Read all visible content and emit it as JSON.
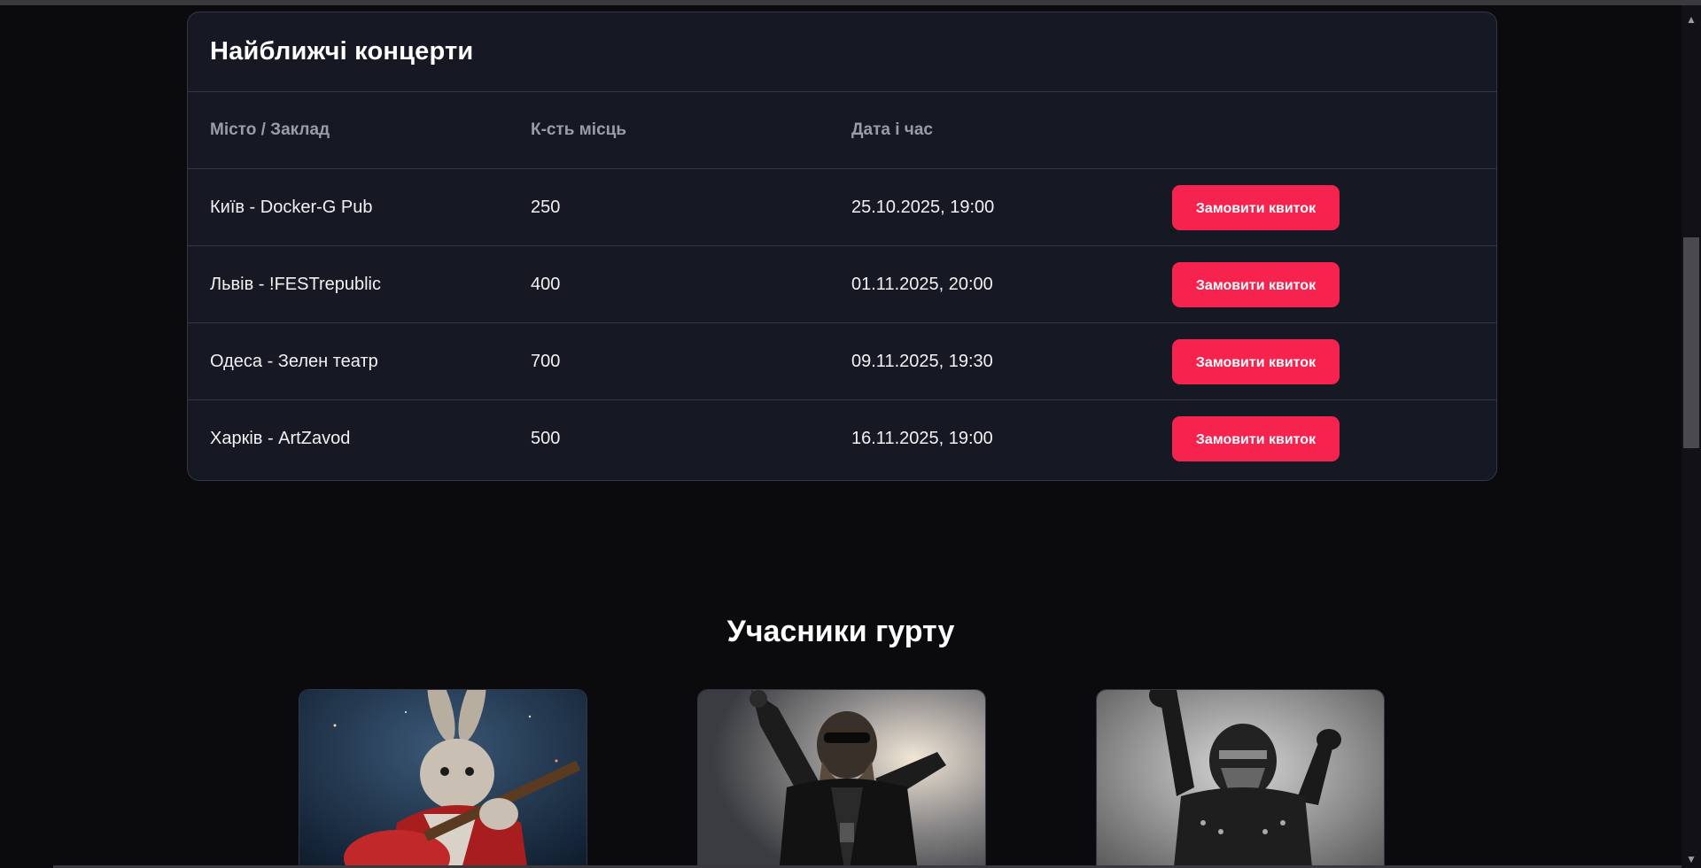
{
  "concerts": {
    "title": "Найближчі концерти",
    "columns": [
      "Місто / Заклад",
      "К-сть місць",
      "Дата і час",
      ""
    ],
    "button_label": "Замовити квиток",
    "rows": [
      {
        "venue": "Київ - Docker-G Pub",
        "seats": "250",
        "datetime": "25.10.2025, 19:00"
      },
      {
        "venue": "Львів - !FESTrepublic",
        "seats": "400",
        "datetime": "01.11.2025, 20:00"
      },
      {
        "venue": "Одеса - Зелен театр",
        "seats": "700",
        "datetime": "09.11.2025, 19:30"
      },
      {
        "venue": "Харків - ArtZavod",
        "seats": "500",
        "datetime": "16.11.2025, 19:00"
      }
    ]
  },
  "members": {
    "title": "Учасники гурту",
    "items": [
      {
        "image": "rabbit-guitarist-photo"
      },
      {
        "image": "gorilla-rocker-photo"
      },
      {
        "image": "masked-warrior-photo"
      }
    ]
  },
  "colors": {
    "background": "#0b0b0e",
    "card": "#161824",
    "accent": "#f5234e",
    "muted_text": "#9a9ca6"
  }
}
